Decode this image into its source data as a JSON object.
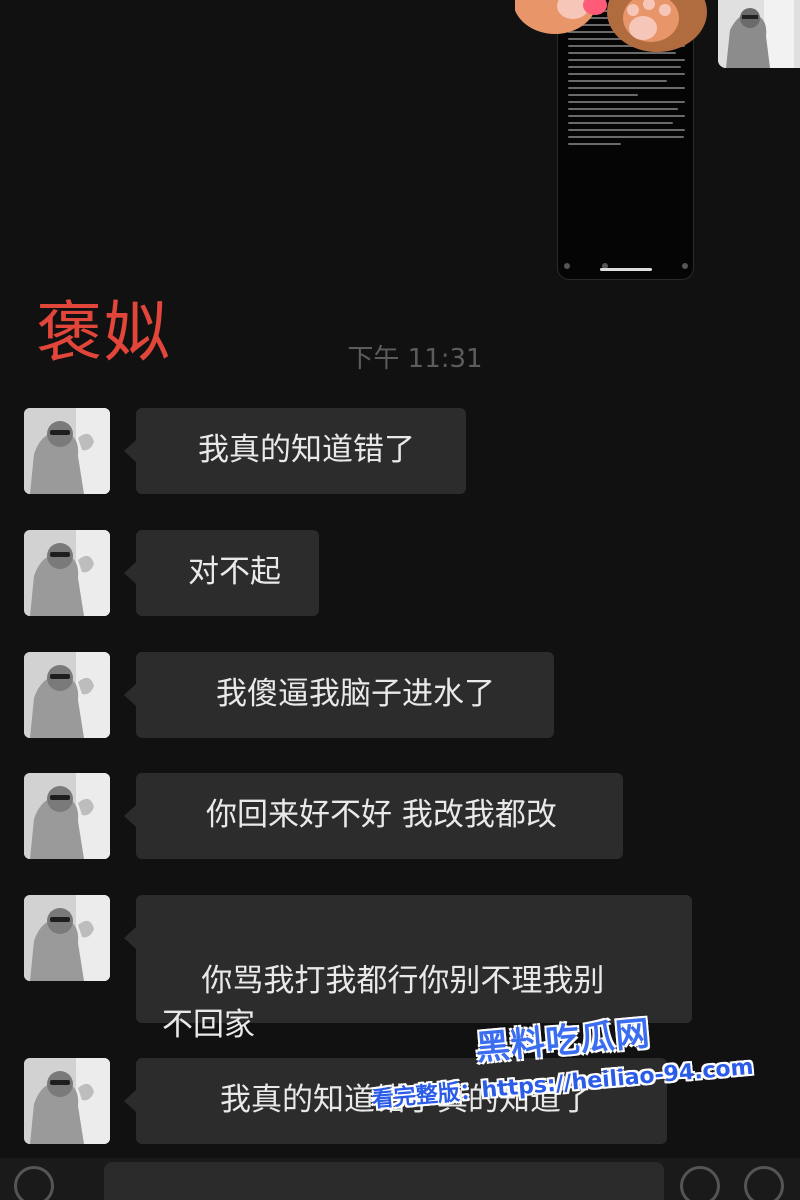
{
  "overlay_label": "褒姒",
  "timestamp": "下午 11:31",
  "messages": [
    {
      "text": "我真的知道错了"
    },
    {
      "text": "对不起"
    },
    {
      "text": "我傻逼我脑子进水了"
    },
    {
      "text": "你回来好不好 我改我都改"
    },
    {
      "text": "你骂我打我都行你别不理我别\n不回家"
    },
    {
      "text": "我真的知道错了真的知道了"
    }
  ],
  "watermark": {
    "brand": "黑料吃瓜网",
    "url_line": "看完整版：https://heiliao-94.com"
  },
  "colors": {
    "background": "#111111",
    "bubble": "#2c2c2c",
    "overlay_label": "#e2463a",
    "watermark": "#3b6df0"
  }
}
